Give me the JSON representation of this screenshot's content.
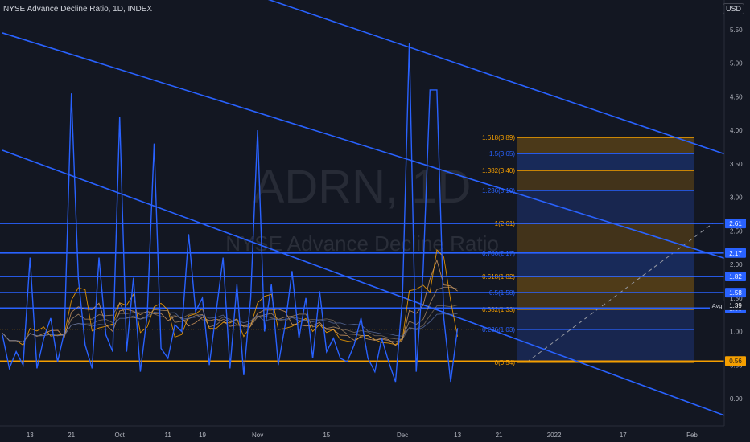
{
  "header": {
    "title": "NYSE Advance Decline Ratio, 1D, INDEX"
  },
  "currency": "USD",
  "watermark": {
    "symbol": "ADRN, 1D",
    "name": "NYSE Advance Decline Ratio"
  },
  "colors": {
    "background": "#131722",
    "line": "#2962ff",
    "orange": "#f59f00",
    "fib_blue": "#2962ff",
    "grid_text": "#b2b5be"
  },
  "chart_data": {
    "type": "line",
    "ylim": [
      -0.3,
      5.75
    ],
    "y_ticks": [
      "5.50",
      "5.00",
      "4.50",
      "4.00",
      "3.50",
      "3.00",
      "2.50",
      "2.00",
      "1.50",
      "1.00",
      "0.50",
      "0.00"
    ],
    "y_tick_values": [
      5.5,
      5.0,
      4.5,
      4.0,
      3.5,
      3.0,
      2.5,
      2.0,
      1.5,
      1.0,
      0.5,
      0.0
    ],
    "x_ticks": [
      "13",
      "21",
      "Oct",
      "11",
      "19",
      "Nov",
      "15",
      "Dec",
      "13",
      "21",
      "2022",
      "17",
      "Feb"
    ],
    "x_tick_index": [
      4,
      10,
      17,
      24,
      29,
      37,
      47,
      58,
      66,
      72,
      80,
      90,
      100
    ],
    "x_max_index": 106,
    "series": [
      {
        "values": [
          0.95,
          0.45,
          0.7,
          0.5,
          2.1,
          0.45,
          0.9,
          1.2,
          0.55,
          1.0,
          4.55,
          1.8,
          0.8,
          0.45,
          2.1,
          0.95,
          0.7,
          4.2,
          0.7,
          1.8,
          0.4,
          1.25,
          3.8,
          0.75,
          0.6,
          1.1,
          1.0,
          2.45,
          1.3,
          1.5,
          0.5,
          1.3,
          2.1,
          0.45,
          1.7,
          0.35,
          1.5,
          4.0,
          1.0,
          1.7,
          0.5,
          1.1,
          1.9,
          0.9,
          1.5,
          0.6,
          1.6,
          0.7,
          0.9,
          0.6,
          0.55,
          0.8,
          1.2,
          0.6,
          0.4,
          0.9,
          0.55,
          0.25,
          1.5,
          5.3,
          0.4,
          1.9,
          4.6,
          4.6,
          1.2,
          0.25,
          1.05
        ],
        "color": "#2962ff"
      }
    ],
    "fib_levels": [
      {
        "label": "1.618(3.89)",
        "value": 3.89,
        "color": "#f59f00"
      },
      {
        "label": "1.5(3.65)",
        "value": 3.65,
        "color": "#2962ff"
      },
      {
        "label": "1.382(3.40)",
        "value": 3.4,
        "color": "#f59f00"
      },
      {
        "label": "1.236(3.10)",
        "value": 3.1,
        "color": "#2962ff"
      },
      {
        "label": "1(2.61)",
        "value": 2.61,
        "color": "#f59f00"
      },
      {
        "label": "0.786(2.17)",
        "value": 2.17,
        "color": "#2962ff"
      },
      {
        "label": "0.618(1.82)",
        "value": 1.82,
        "color": "#f59f00"
      },
      {
        "label": "0.5(1.58)",
        "value": 1.58,
        "color": "#2962ff"
      },
      {
        "label": "0.382(1.33)",
        "value": 1.33,
        "color": "#f59f00"
      },
      {
        "label": "0.236(1.03)",
        "value": 1.03,
        "color": "#2962ff"
      },
      {
        "label": "0(0.54)",
        "value": 0.54,
        "color": "#f59f00"
      }
    ],
    "horizontal_lines": [
      {
        "value": 2.61,
        "color": "#2962ff",
        "badge": "2.61"
      },
      {
        "value": 2.17,
        "color": "#2962ff",
        "badge": "2.17"
      },
      {
        "value": 1.82,
        "color": "#2962ff",
        "badge": "1.82"
      },
      {
        "value": 1.58,
        "color": "#2962ff",
        "badge": "1.58"
      },
      {
        "value": 1.35,
        "color": "#2962ff",
        "badge": "1.35"
      },
      {
        "value": 0.56,
        "color": "#f59f00",
        "badge": "0.56"
      }
    ],
    "avg": {
      "label": "Avg",
      "value": "1.39",
      "level": 1.39
    },
    "trend_lines": [
      {
        "x1": 27,
        "y1": 6.35,
        "x2": 106,
        "y2": 3.6
      },
      {
        "x1": 0,
        "y1": 5.45,
        "x2": 106,
        "y2": 2.05
      },
      {
        "x1": 0,
        "y1": 3.7,
        "x2": 106,
        "y2": -0.3
      }
    ],
    "projection": {
      "x1": 76,
      "y1": 0.54,
      "x2": 103,
      "y2": 2.61
    }
  }
}
